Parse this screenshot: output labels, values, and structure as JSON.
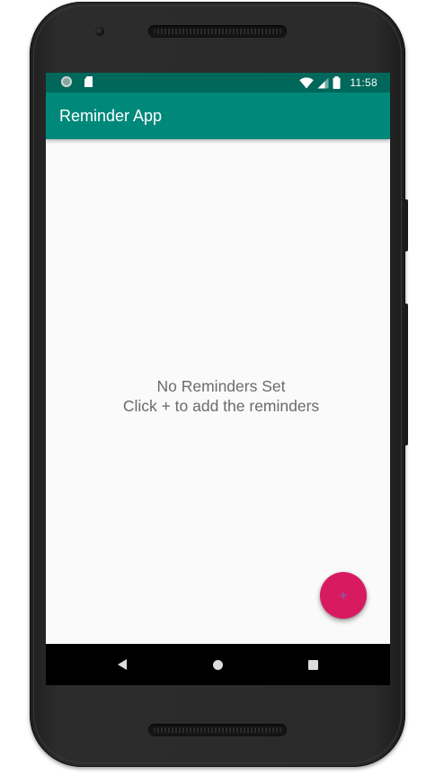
{
  "status_bar": {
    "time": "11:58",
    "left_icons": [
      "sync-icon",
      "sd-card-icon"
    ],
    "right_icons": [
      "wifi-icon",
      "cell-signal-icon",
      "battery-icon"
    ]
  },
  "app_bar": {
    "title": "Reminder App"
  },
  "content": {
    "empty_title": "No Reminders Set",
    "empty_hint": "Click + to add the reminders"
  },
  "fab": {
    "label": "+",
    "icon": "add-icon"
  },
  "nav_bar": {
    "buttons": [
      "back-icon",
      "home-icon",
      "recents-icon"
    ]
  },
  "colors": {
    "status_bar": "#00685b",
    "app_bar": "#00897b",
    "fab": "#d81b60",
    "background": "#fafafa",
    "text_secondary": "#6b6b6b"
  }
}
